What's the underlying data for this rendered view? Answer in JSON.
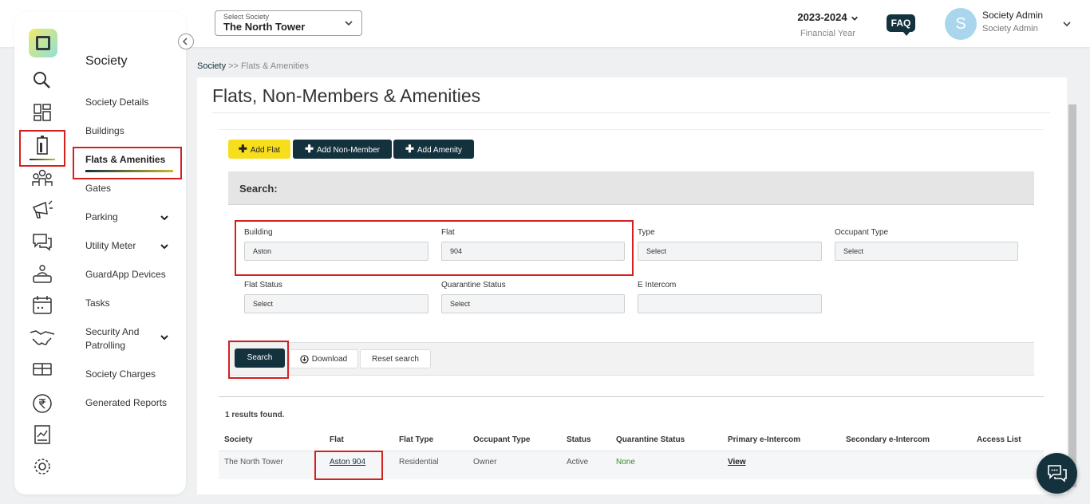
{
  "header": {
    "society_select_label": "Select Society",
    "society_select_value": "The North Tower",
    "financial_year": "2023-2024",
    "financial_year_label": "Financial Year",
    "faq": "FAQ",
    "avatar_initial": "S",
    "user_name": "Society Admin",
    "user_role": "Society Admin"
  },
  "sidebar": {
    "section_title": "Society",
    "items": [
      {
        "label": "Society Details"
      },
      {
        "label": "Buildings"
      },
      {
        "label": "Flats & Amenities"
      },
      {
        "label": "Gates"
      },
      {
        "label": "Parking"
      },
      {
        "label": "Utility Meter"
      },
      {
        "label": "GuardApp Devices"
      },
      {
        "label": "Tasks"
      },
      {
        "label": "Security And Patrolling"
      },
      {
        "label": "Society Charges"
      },
      {
        "label": "Generated Reports"
      }
    ],
    "icons": [
      "search-icon",
      "dashboard-icon",
      "building-icon",
      "members-icon",
      "announcement-icon",
      "chat-icon",
      "helpdesk-icon",
      "calendar-icon",
      "handshake-icon",
      "gift-icon",
      "rupee-icon",
      "report-icon",
      "gear-icon"
    ]
  },
  "breadcrumb": {
    "root": "Society",
    "separator": " >> ",
    "current": "Flats & Amenities"
  },
  "page": {
    "title": "Flats, Non-Members & Amenities"
  },
  "toolbar": {
    "add_flat": "Add Flat",
    "add_non_member": "Add Non-Member",
    "add_amenity": "Add Amenity"
  },
  "search": {
    "heading": "Search:",
    "building_label": "Building",
    "building_value": "Aston",
    "flat_label": "Flat",
    "flat_value": "904",
    "type_label": "Type",
    "type_value": "Select",
    "occupant_type_label": "Occupant Type",
    "occupant_type_value": "Select",
    "flat_status_label": "Flat Status",
    "flat_status_value": "Select",
    "quarantine_status_label": "Quarantine Status",
    "quarantine_status_value": "Select",
    "e_intercom_label": "E Intercom",
    "e_intercom_value": "",
    "search_btn": "Search",
    "download_btn": "Download",
    "reset_btn": "Reset search"
  },
  "results": {
    "summary": "1 results found.",
    "columns": [
      "Society",
      "Flat",
      "Flat Type",
      "Occupant Type",
      "Status",
      "Quarantine Status",
      "Primary e-Intercom",
      "Secondary e-Intercom",
      "Access List"
    ],
    "rows": [
      {
        "society": "The North Tower",
        "flat": "Aston 904",
        "flat_type": "Residential",
        "occupant_type": "Owner",
        "status": "Active",
        "quarantine_status": "None",
        "primary_intercom": "View",
        "secondary_intercom": "",
        "access_list": ""
      }
    ]
  },
  "colors": {
    "primary": "#14323d",
    "accent": "#f6de1d",
    "highlight": "#d62020",
    "success": "#3a8c2a"
  }
}
